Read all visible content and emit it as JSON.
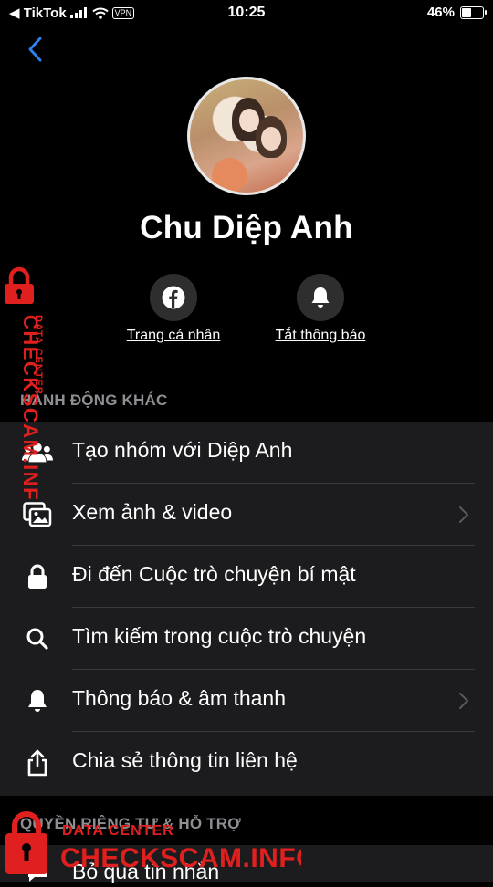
{
  "status_bar": {
    "carrier": "◀ TikTok",
    "vpn": "VPN",
    "time": "10:25",
    "battery": "46%",
    "battery_level": 0.46
  },
  "profile": {
    "name": "Chu Diệp Anh"
  },
  "quick_actions": [
    {
      "label": "Trang cá nhân",
      "icon": "facebook-icon"
    },
    {
      "label": "Tắt thông báo",
      "icon": "bell-icon"
    }
  ],
  "sections": {
    "more_actions": "HÀNH ĐỘNG KHÁC",
    "privacy": "QUYỀN RIÊNG TƯ & HỖ TRỢ"
  },
  "menu": [
    {
      "label": "Tạo nhóm với Diệp Anh",
      "icon": "group-icon",
      "chevron": false
    },
    {
      "label": "Xem ảnh & video",
      "icon": "photos-icon",
      "chevron": true
    },
    {
      "label": "Đi đến Cuộc trò chuyện bí mật",
      "icon": "lock-icon",
      "chevron": false
    },
    {
      "label": "Tìm kiếm trong cuộc trò chuyện",
      "icon": "search-icon",
      "chevron": false
    },
    {
      "label": "Thông báo & âm thanh",
      "icon": "bell-icon",
      "chevron": true
    },
    {
      "label": "Chia sẻ thông tin liên hệ",
      "icon": "share-icon",
      "chevron": false
    }
  ],
  "privacy_menu": [
    {
      "label": "Bỏ qua tin nhắn"
    }
  ],
  "watermark": {
    "subtitle": "DATA CENTER",
    "title": "CHECKSCAM.INFO",
    "color": "#e0201e"
  },
  "colors": {
    "accent": "#2f80ed",
    "panel": "#1c1c1e",
    "section_text": "#8e8e93"
  }
}
